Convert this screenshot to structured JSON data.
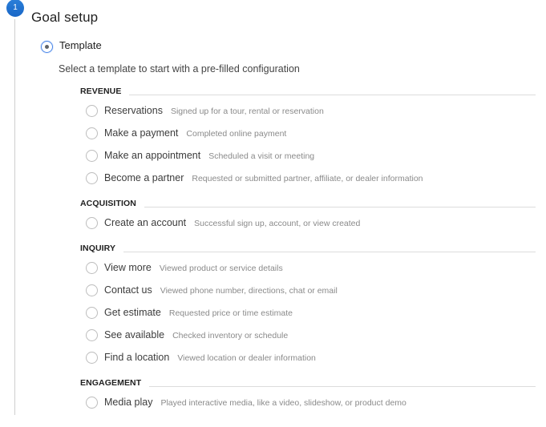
{
  "step": {
    "number": "1",
    "title": "Goal setup"
  },
  "template_option": {
    "label": "Template",
    "selected": true
  },
  "instructions": "Select a template to start with a pre-filled configuration",
  "colors": {
    "accent": "#1a73e8",
    "divider": "#dcdcdc",
    "description": "#8a8a8a"
  },
  "sections": [
    {
      "header": "REVENUE",
      "options": [
        {
          "label": "Reservations",
          "description": "Signed up for a tour, rental or reservation"
        },
        {
          "label": "Make a payment",
          "description": "Completed online payment"
        },
        {
          "label": "Make an appointment",
          "description": "Scheduled a visit or meeting"
        },
        {
          "label": "Become a partner",
          "description": "Requested or submitted partner, affiliate, or dealer information"
        }
      ]
    },
    {
      "header": "ACQUISITION",
      "options": [
        {
          "label": "Create an account",
          "description": "Successful sign up, account, or view created"
        }
      ]
    },
    {
      "header": "INQUIRY",
      "options": [
        {
          "label": "View more",
          "description": "Viewed product or service details"
        },
        {
          "label": "Contact us",
          "description": "Viewed phone number, directions, chat or email"
        },
        {
          "label": "Get estimate",
          "description": "Requested price or time estimate"
        },
        {
          "label": "See available",
          "description": "Checked inventory or schedule"
        },
        {
          "label": "Find a location",
          "description": "Viewed location or dealer information"
        }
      ]
    },
    {
      "header": "ENGAGEMENT",
      "options": [
        {
          "label": "Media play",
          "description": "Played interactive media, like a video, slideshow, or product demo"
        }
      ]
    }
  ]
}
